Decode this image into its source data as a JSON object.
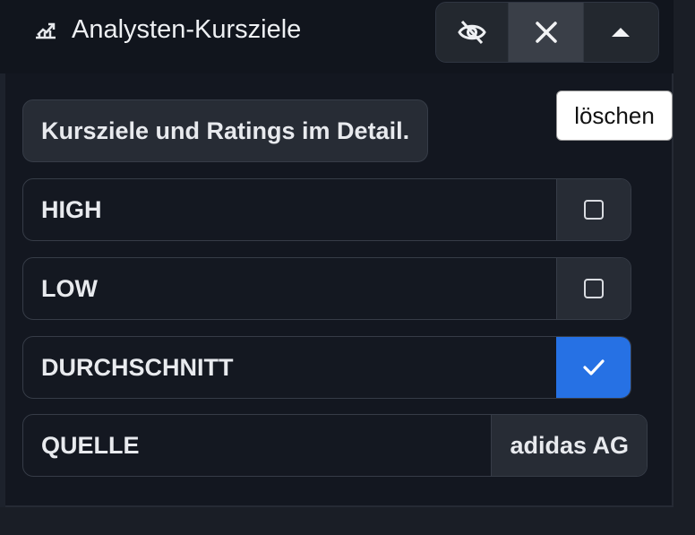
{
  "header": {
    "title": "Analysten-Kursziele",
    "title_icon": "chart-line-up-icon",
    "buttons": [
      {
        "icon": "eye-off-icon"
      },
      {
        "icon": "close-icon"
      },
      {
        "icon": "caret-up-icon"
      }
    ]
  },
  "tooltip": {
    "text": "löschen"
  },
  "description": "Kursziele und Ratings im Detail.",
  "options": [
    {
      "label": "HIGH",
      "checked": false
    },
    {
      "label": "LOW",
      "checked": false
    },
    {
      "label": "DURCHSCHNITT",
      "checked": true
    }
  ],
  "source": {
    "label": "QUELLE",
    "value": "adidas AG"
  },
  "colors": {
    "accent": "#2671e4",
    "background": "#131720"
  }
}
